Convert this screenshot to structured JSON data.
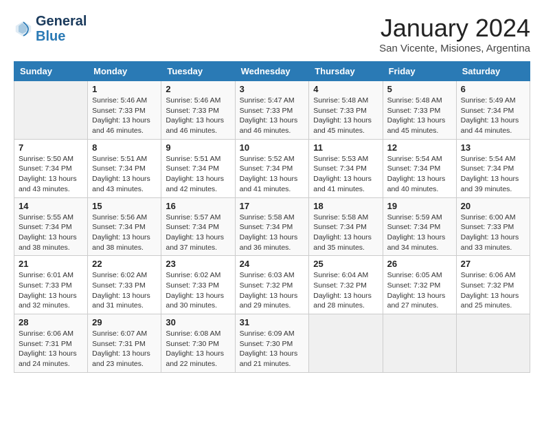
{
  "header": {
    "logo_line1": "General",
    "logo_line2": "Blue",
    "month": "January 2024",
    "location": "San Vicente, Misiones, Argentina"
  },
  "days_of_week": [
    "Sunday",
    "Monday",
    "Tuesday",
    "Wednesday",
    "Thursday",
    "Friday",
    "Saturday"
  ],
  "weeks": [
    [
      {
        "day": "",
        "info": ""
      },
      {
        "day": "1",
        "info": "Sunrise: 5:46 AM\nSunset: 7:33 PM\nDaylight: 13 hours\nand 46 minutes."
      },
      {
        "day": "2",
        "info": "Sunrise: 5:46 AM\nSunset: 7:33 PM\nDaylight: 13 hours\nand 46 minutes."
      },
      {
        "day": "3",
        "info": "Sunrise: 5:47 AM\nSunset: 7:33 PM\nDaylight: 13 hours\nand 46 minutes."
      },
      {
        "day": "4",
        "info": "Sunrise: 5:48 AM\nSunset: 7:33 PM\nDaylight: 13 hours\nand 45 minutes."
      },
      {
        "day": "5",
        "info": "Sunrise: 5:48 AM\nSunset: 7:33 PM\nDaylight: 13 hours\nand 45 minutes."
      },
      {
        "day": "6",
        "info": "Sunrise: 5:49 AM\nSunset: 7:34 PM\nDaylight: 13 hours\nand 44 minutes."
      }
    ],
    [
      {
        "day": "7",
        "info": "Sunrise: 5:50 AM\nSunset: 7:34 PM\nDaylight: 13 hours\nand 43 minutes."
      },
      {
        "day": "8",
        "info": "Sunrise: 5:51 AM\nSunset: 7:34 PM\nDaylight: 13 hours\nand 43 minutes."
      },
      {
        "day": "9",
        "info": "Sunrise: 5:51 AM\nSunset: 7:34 PM\nDaylight: 13 hours\nand 42 minutes."
      },
      {
        "day": "10",
        "info": "Sunrise: 5:52 AM\nSunset: 7:34 PM\nDaylight: 13 hours\nand 41 minutes."
      },
      {
        "day": "11",
        "info": "Sunrise: 5:53 AM\nSunset: 7:34 PM\nDaylight: 13 hours\nand 41 minutes."
      },
      {
        "day": "12",
        "info": "Sunrise: 5:54 AM\nSunset: 7:34 PM\nDaylight: 13 hours\nand 40 minutes."
      },
      {
        "day": "13",
        "info": "Sunrise: 5:54 AM\nSunset: 7:34 PM\nDaylight: 13 hours\nand 39 minutes."
      }
    ],
    [
      {
        "day": "14",
        "info": "Sunrise: 5:55 AM\nSunset: 7:34 PM\nDaylight: 13 hours\nand 38 minutes."
      },
      {
        "day": "15",
        "info": "Sunrise: 5:56 AM\nSunset: 7:34 PM\nDaylight: 13 hours\nand 38 minutes."
      },
      {
        "day": "16",
        "info": "Sunrise: 5:57 AM\nSunset: 7:34 PM\nDaylight: 13 hours\nand 37 minutes."
      },
      {
        "day": "17",
        "info": "Sunrise: 5:58 AM\nSunset: 7:34 PM\nDaylight: 13 hours\nand 36 minutes."
      },
      {
        "day": "18",
        "info": "Sunrise: 5:58 AM\nSunset: 7:34 PM\nDaylight: 13 hours\nand 35 minutes."
      },
      {
        "day": "19",
        "info": "Sunrise: 5:59 AM\nSunset: 7:34 PM\nDaylight: 13 hours\nand 34 minutes."
      },
      {
        "day": "20",
        "info": "Sunrise: 6:00 AM\nSunset: 7:33 PM\nDaylight: 13 hours\nand 33 minutes."
      }
    ],
    [
      {
        "day": "21",
        "info": "Sunrise: 6:01 AM\nSunset: 7:33 PM\nDaylight: 13 hours\nand 32 minutes."
      },
      {
        "day": "22",
        "info": "Sunrise: 6:02 AM\nSunset: 7:33 PM\nDaylight: 13 hours\nand 31 minutes."
      },
      {
        "day": "23",
        "info": "Sunrise: 6:02 AM\nSunset: 7:33 PM\nDaylight: 13 hours\nand 30 minutes."
      },
      {
        "day": "24",
        "info": "Sunrise: 6:03 AM\nSunset: 7:32 PM\nDaylight: 13 hours\nand 29 minutes."
      },
      {
        "day": "25",
        "info": "Sunrise: 6:04 AM\nSunset: 7:32 PM\nDaylight: 13 hours\nand 28 minutes."
      },
      {
        "day": "26",
        "info": "Sunrise: 6:05 AM\nSunset: 7:32 PM\nDaylight: 13 hours\nand 27 minutes."
      },
      {
        "day": "27",
        "info": "Sunrise: 6:06 AM\nSunset: 7:32 PM\nDaylight: 13 hours\nand 25 minutes."
      }
    ],
    [
      {
        "day": "28",
        "info": "Sunrise: 6:06 AM\nSunset: 7:31 PM\nDaylight: 13 hours\nand 24 minutes."
      },
      {
        "day": "29",
        "info": "Sunrise: 6:07 AM\nSunset: 7:31 PM\nDaylight: 13 hours\nand 23 minutes."
      },
      {
        "day": "30",
        "info": "Sunrise: 6:08 AM\nSunset: 7:30 PM\nDaylight: 13 hours\nand 22 minutes."
      },
      {
        "day": "31",
        "info": "Sunrise: 6:09 AM\nSunset: 7:30 PM\nDaylight: 13 hours\nand 21 minutes."
      },
      {
        "day": "",
        "info": ""
      },
      {
        "day": "",
        "info": ""
      },
      {
        "day": "",
        "info": ""
      }
    ]
  ]
}
